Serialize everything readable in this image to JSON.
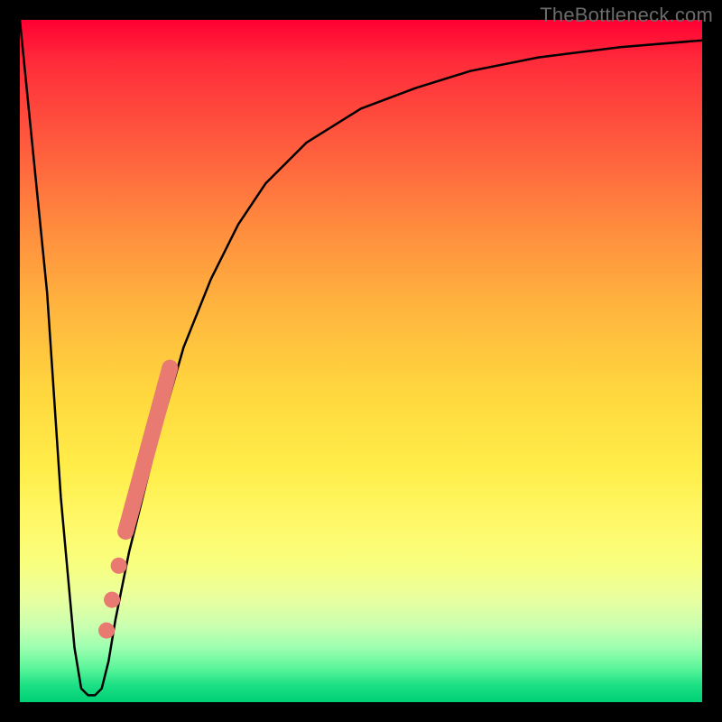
{
  "watermark": "TheBottleneck.com",
  "colors": {
    "background_black": "#000000",
    "curve": "#000000",
    "marker": "#e97a72",
    "gradient_top": "#ff0033",
    "gradient_mid": "#ffee4a",
    "gradient_bottom": "#00d074"
  },
  "chart_data": {
    "type": "line",
    "title": "",
    "xlabel": "",
    "ylabel": "",
    "xlim": [
      0,
      100
    ],
    "ylim": [
      0,
      100
    ],
    "grid": false,
    "legend": false,
    "series": [
      {
        "name": "bottleneck-curve",
        "x": [
          0,
          4,
          6,
          8,
          9,
          10,
          11,
          12,
          13,
          14,
          16,
          18,
          20,
          22,
          24,
          28,
          32,
          36,
          42,
          50,
          58,
          66,
          76,
          88,
          100
        ],
        "y": [
          100,
          60,
          30,
          8,
          2,
          1,
          1,
          2,
          6,
          12,
          22,
          30,
          38,
          45,
          52,
          62,
          70,
          76,
          82,
          87,
          90,
          92.5,
          94.5,
          96,
          97
        ]
      }
    ],
    "highlight_segment": {
      "name": "marker-bar",
      "x_start": 15.5,
      "y_start": 25,
      "x_end": 22,
      "y_end": 49
    },
    "highlight_points": [
      {
        "x": 14.5,
        "y": 20
      },
      {
        "x": 13.5,
        "y": 15
      },
      {
        "x": 12.7,
        "y": 10.5
      }
    ]
  }
}
